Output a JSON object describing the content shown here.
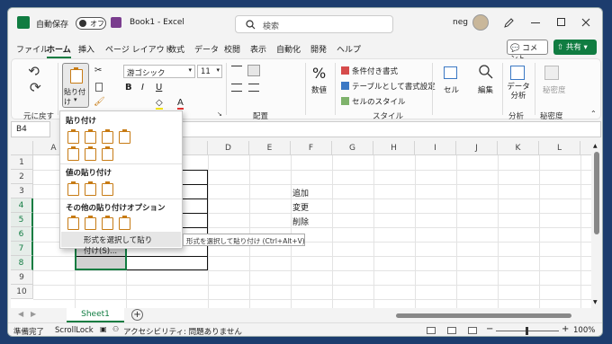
{
  "titlebar": {
    "autosave_label": "自動保存",
    "autosave_state": "オフ",
    "doc_title": "Book1 - Excel",
    "search_placeholder": "検索",
    "user": "neg"
  },
  "tabs": [
    "ファイル",
    "ホーム",
    "挿入",
    "ページ レイアウト",
    "数式",
    "データ",
    "校閲",
    "表示",
    "自動化",
    "開発",
    "ヘルプ"
  ],
  "actions": {
    "comment": "コメント",
    "share": "共有"
  },
  "ribbon": {
    "undo_label": "元に戻す",
    "paste_label": "貼り付け",
    "font_name": "游ゴシック",
    "font_size": "11",
    "align_group": "配置",
    "number_label": "数値",
    "cond_format": "条件付き書式",
    "table_format": "テーブルとして書式設定",
    "cell_style": "セルのスタイル",
    "style_group": "スタイル",
    "cells_label": "セル",
    "edit_label": "編集",
    "analyze_data": "データ分析",
    "analysis_group": "分析",
    "sensitivity_label": "秘密度",
    "sensitivity_group": "秘密度"
  },
  "formula_bar": {
    "name_box": "B4",
    "fx": "fx"
  },
  "grid": {
    "columns": [
      "A",
      "B",
      "C",
      "D",
      "E",
      "F",
      "G",
      "H",
      "I",
      "J",
      "K",
      "L"
    ],
    "rows": [
      "1",
      "2",
      "3",
      "4",
      "5",
      "6",
      "7",
      "8",
      "9",
      "10"
    ],
    "cells": {
      "F3": "追加",
      "F4": "変更",
      "F5": "削除"
    }
  },
  "paste_menu": {
    "section1": "貼り付け",
    "section2": "値の貼り付け",
    "section3": "その他の貼り付けオプション",
    "special_item": "形式を選択して貼り付け(S)...",
    "tooltip": "形式を選択して貼り付け (Ctrl+Alt+V)"
  },
  "sheets": [
    "Sheet1"
  ],
  "status": {
    "ready": "準備完了",
    "scroll_lock": "ScrollLock",
    "accessibility": "アクセシビリティ: 問題ありません",
    "zoom": "100%"
  },
  "colors": {
    "accent": "#107c41",
    "paste_icon": "#c77b14"
  }
}
